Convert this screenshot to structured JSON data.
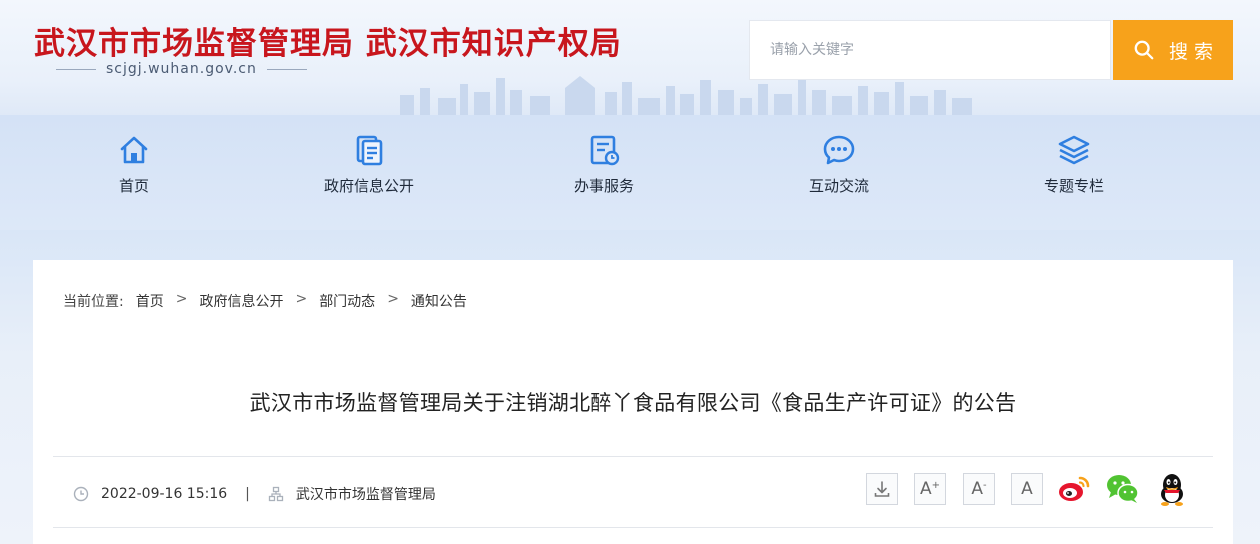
{
  "header": {
    "site_title": "武汉市市场监督管理局 武汉市知识产权局",
    "domain": "scjgj.wuhan.gov.cn",
    "search_placeholder": "请输入关键字",
    "search_button": "搜 索"
  },
  "nav": {
    "items": [
      {
        "label": "首页",
        "icon": "home-icon"
      },
      {
        "label": "政府信息公开",
        "icon": "document-icon"
      },
      {
        "label": "办事服务",
        "icon": "service-icon"
      },
      {
        "label": "互动交流",
        "icon": "chat-icon"
      },
      {
        "label": "专题专栏",
        "icon": "layers-icon"
      }
    ]
  },
  "breadcrumb": {
    "lead": "当前位置:",
    "items": [
      "首页",
      "政府信息公开",
      "部门动态",
      "通知公告"
    ],
    "separator": ">"
  },
  "article": {
    "title": "武汉市市场监督管理局关于注销湖北醉丫食品有限公司《食品生产许可证》的公告",
    "date": "2022-09-16 15:16",
    "divider": "|",
    "source": "武汉市市场监督管理局"
  },
  "tools": {
    "font_increase": "A",
    "font_increase_mark": "+",
    "font_decrease": "A",
    "font_decrease_mark": "-",
    "font_reset": "A"
  },
  "colors": {
    "brand_red": "#c8161d",
    "accent_orange": "#f7a21b",
    "icon_blue": "#2f7fe0"
  }
}
